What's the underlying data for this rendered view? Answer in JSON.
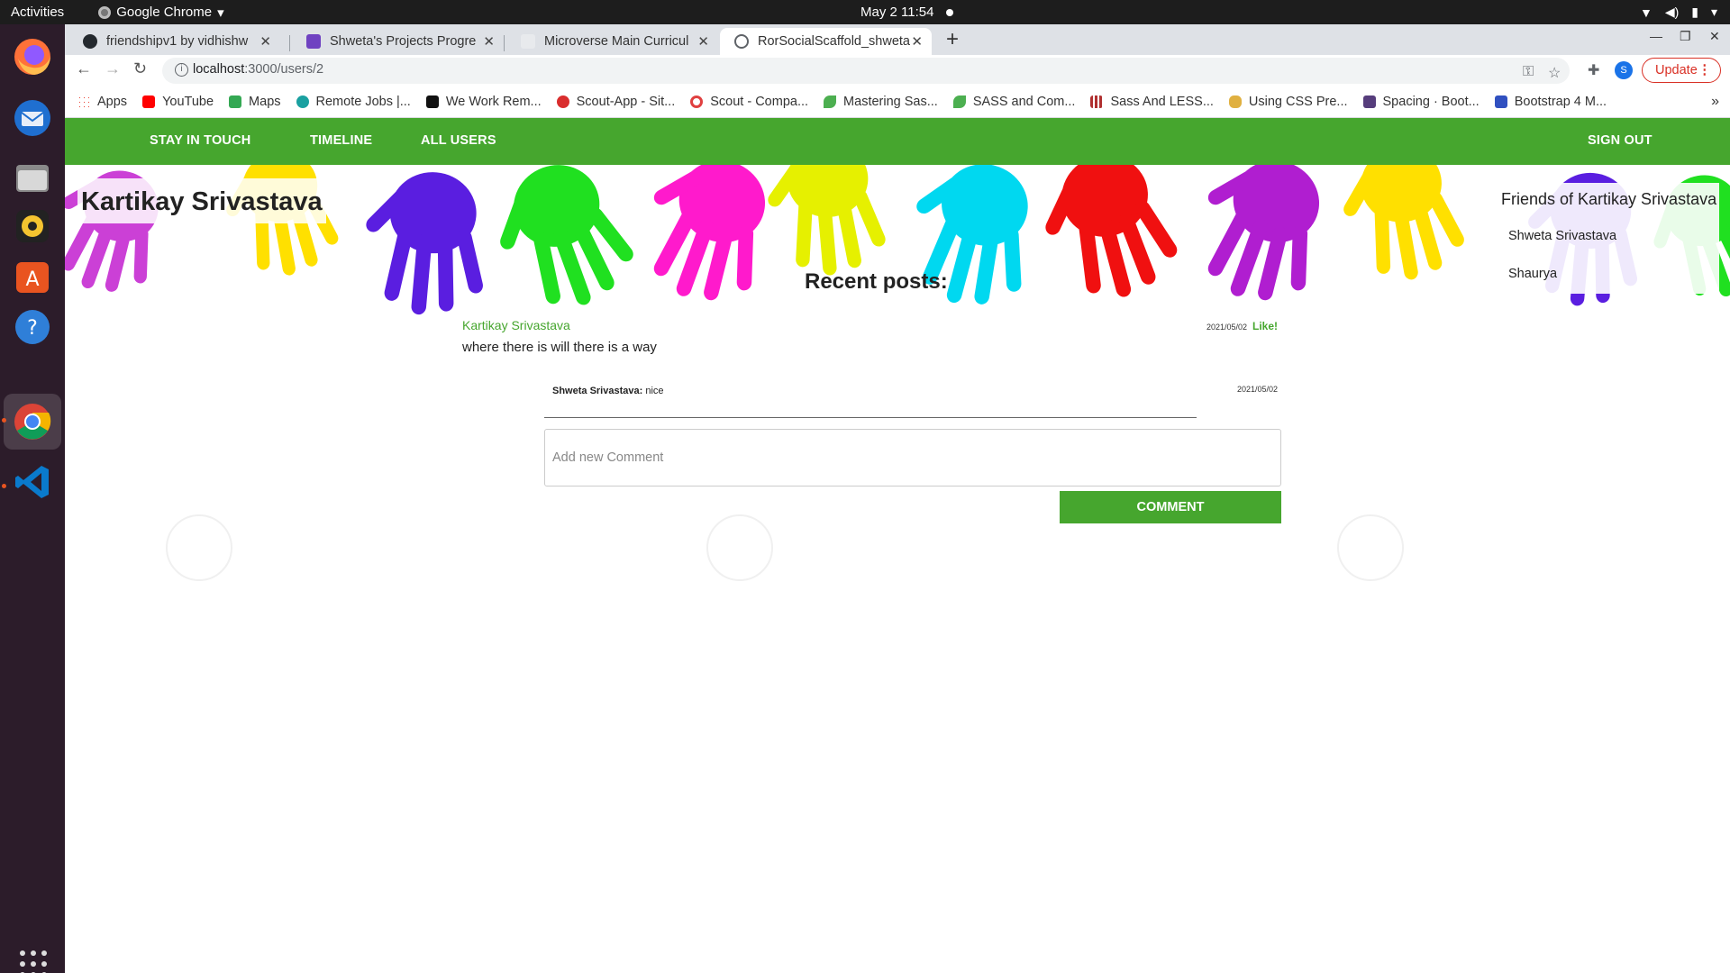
{
  "os": {
    "activities": "Activities",
    "app_name": "Google Chrome",
    "clock": "May 2  11:54"
  },
  "browser": {
    "tabs": [
      {
        "title": "friendshipv1 by vidhishw",
        "favicon_color": "#24292e"
      },
      {
        "title": "Shweta's Projects Progre",
        "favicon_color": "#6f42c1"
      },
      {
        "title": "Microverse Main Curricul",
        "favicon_color": "#e8eaed"
      },
      {
        "title": "RorSocialScaffold_shweta",
        "favicon_color": "#5f6368"
      }
    ],
    "url_host": "localhost",
    "url_path": ":3000/users/2",
    "profile_initial": "S",
    "update_label": "Update",
    "bookmarks": [
      {
        "label": "Apps",
        "color": "#4285f4"
      },
      {
        "label": "YouTube",
        "color": "#ff0000"
      },
      {
        "label": "Maps",
        "color": "#34a853"
      },
      {
        "label": "Remote Jobs |...",
        "color": "#1aa0a0"
      },
      {
        "label": "We Work Rem...",
        "color": "#111111"
      },
      {
        "label": "Scout-App - Sit...",
        "color": "#d92d2d"
      },
      {
        "label": "Scout - Compa...",
        "color": "#e04040"
      },
      {
        "label": "Mastering Sas...",
        "color": "#4caf50"
      },
      {
        "label": "SASS and Com...",
        "color": "#4caf50"
      },
      {
        "label": "Sass And LESS...",
        "color": "#b03030"
      },
      {
        "label": "Using CSS Pre...",
        "color": "#e0b040"
      },
      {
        "label": "Spacing · Boot...",
        "color": "#563d7c"
      },
      {
        "label": "Bootstrap 4 M...",
        "color": "#3050c0"
      }
    ]
  },
  "nav": {
    "stay_in_touch": "STAY IN TOUCH",
    "timeline": "TIMELINE",
    "all_users": "ALL USERS",
    "sign_out": "SIGN OUT"
  },
  "profile": {
    "name": "Kartikay Srivastava"
  },
  "friends": {
    "title": "Friends of Kartikay Srivastava",
    "items": [
      "Shweta Srivastava",
      "Shaurya"
    ]
  },
  "posts": {
    "title": "Recent posts:",
    "items": [
      {
        "author": "Kartikay Srivastava",
        "date": "2021/05/02",
        "like_label": "Like!",
        "content": "where there is will there is a way",
        "comments": [
          {
            "author": "Shweta Srivastava:",
            "text": " nice",
            "date": "2021/05/02"
          }
        ]
      }
    ]
  },
  "comment_form": {
    "placeholder": "Add new Comment",
    "button_label": "COMMENT"
  },
  "colors": {
    "accent": "#46a62e",
    "navbar": "#46a62e"
  }
}
